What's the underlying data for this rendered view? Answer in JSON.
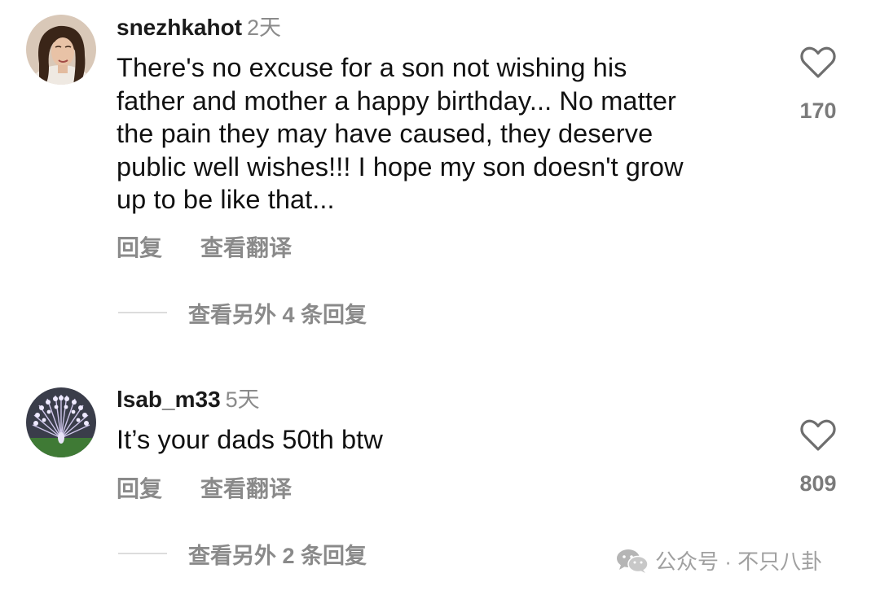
{
  "comments": [
    {
      "username": "snezhkahot",
      "time": "2天",
      "text_lines": [
        "There's no excuse for a son not wishing his",
        "father and mother a happy birthday... No matter",
        "the pain they may have caused, they deserve",
        "public well wishes!!! I hope my son doesn't grow",
        "up to be like that..."
      ],
      "likes": "170",
      "reply_label": "回复",
      "translate_label": "查看翻译",
      "more_replies": "查看另外 4 条回复",
      "avatar_icon": "user-portrait-avatar"
    },
    {
      "username": "lsab_m33",
      "time": "5天",
      "text_lines": [
        "It’s your dads 50th btw"
      ],
      "likes": "809",
      "reply_label": "回复",
      "translate_label": "查看翻译",
      "more_replies": "查看另外 2 条回复",
      "avatar_icon": "peacock-avatar"
    }
  ],
  "watermark": {
    "text": "公众号 · 不只八卦",
    "icon": "wechat-icon"
  },
  "colors": {
    "text_primary": "#111111",
    "text_secondary": "#8a8a8a",
    "divider": "#dcdcdc",
    "background": "#ffffff"
  }
}
